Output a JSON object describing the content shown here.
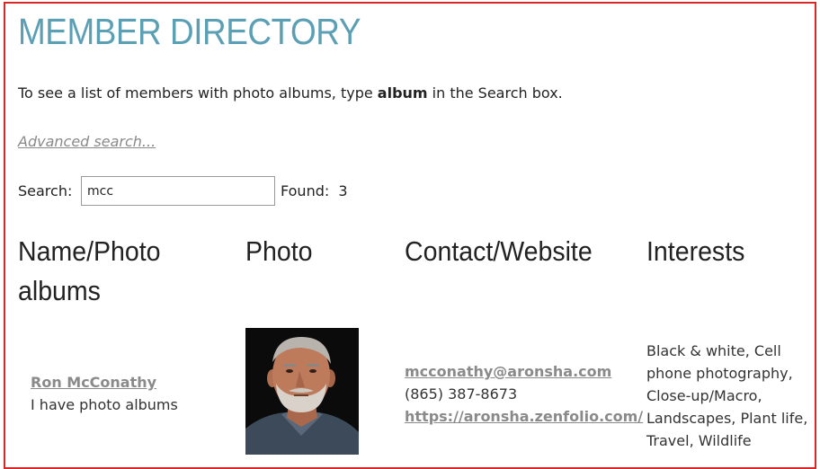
{
  "page": {
    "title": "MEMBER DIRECTORY",
    "intro_before": "To see a list of members with photo albums, type ",
    "intro_keyword": "album",
    "intro_after": " in the Search box.",
    "advanced_search_link": "Advanced search..."
  },
  "search": {
    "label": "Search:",
    "value": "mcc",
    "found_label": "Found:",
    "found_count": "3"
  },
  "table": {
    "headers": {
      "name": "Name/Photo albums",
      "photo": "Photo",
      "contact": "Contact/Website",
      "interests": "Interests"
    },
    "rows": [
      {
        "name": "Ron McConathy",
        "albums_note": "I have photo albums",
        "photo_icon": "member-portrait",
        "email": "mcconathy@aronsha.com",
        "phone": "(865) 387-8673",
        "website": "https://aronsha.zenfolio.com/",
        "interests": "Black & white, Cell phone photography, Close-up/Macro, Landscapes, Plant life, Travel, Wildlife"
      }
    ]
  },
  "colors": {
    "title": "#5b9fb5",
    "frame_border": "#d62828",
    "link": "#8a8a8a"
  }
}
